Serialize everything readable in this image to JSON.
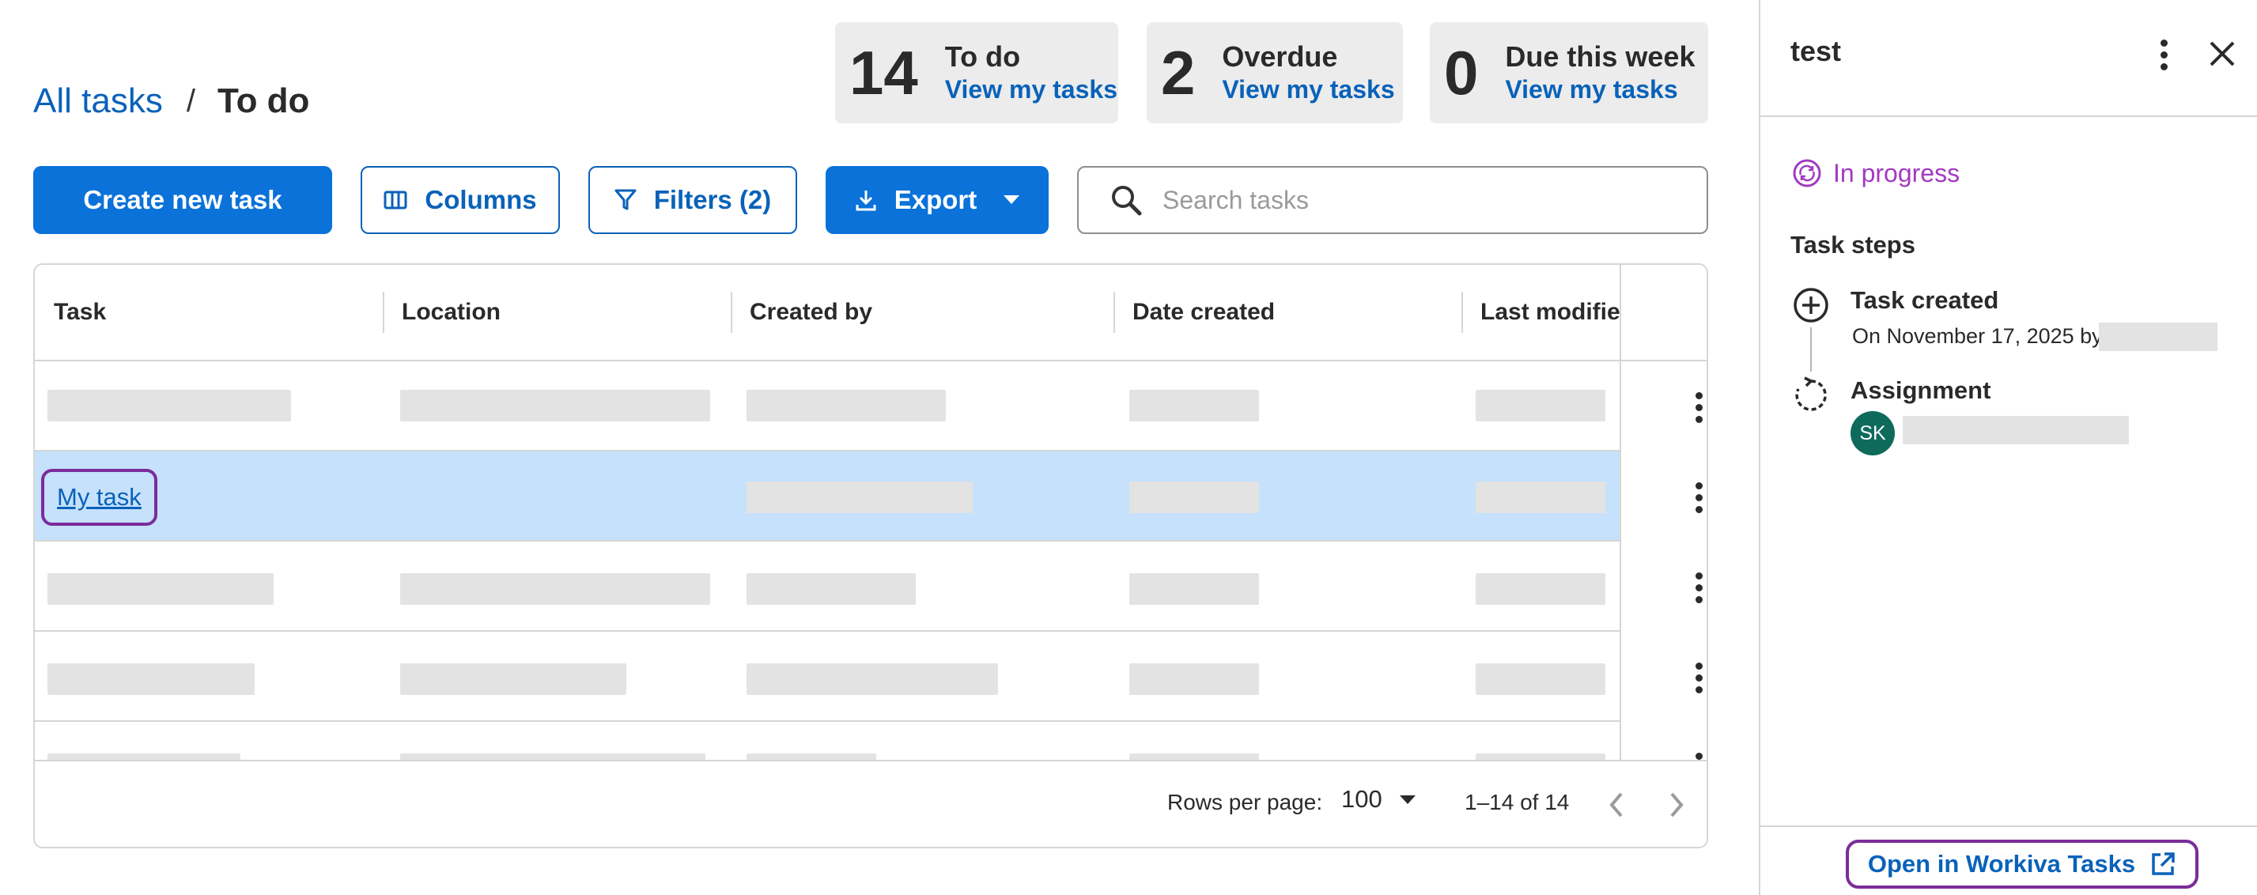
{
  "breadcrumb": {
    "root": "All tasks",
    "separator": "/",
    "current": "To do"
  },
  "stats": [
    {
      "count": "14",
      "label": "To do",
      "link": "View my tasks"
    },
    {
      "count": "2",
      "label": "Overdue",
      "link": "View my tasks"
    },
    {
      "count": "0",
      "label": "Due this week",
      "link": "View my tasks"
    }
  ],
  "toolbar": {
    "create_label": "Create new task",
    "columns_label": "Columns",
    "filters_label": "Filters (2)",
    "export_label": "Export",
    "search_placeholder": "Search tasks"
  },
  "table": {
    "columns": [
      "Task",
      "Location",
      "Created by",
      "Date created",
      "Last modifie"
    ],
    "selected_task": "My task"
  },
  "pagination": {
    "rows_label": "Rows per page:",
    "rows_value": "100",
    "range": "1–14 of 14"
  },
  "panel": {
    "title": "test",
    "status": "In progress",
    "steps_title": "Task steps",
    "steps": [
      {
        "title": "Task created",
        "detail": "On November 17, 2025 by"
      },
      {
        "title": "Assignment",
        "assignee_initials": "SK"
      }
    ],
    "open_label": "Open in Workiva Tasks"
  },
  "colors": {
    "primary": "#0a72d9",
    "link": "#0a62b9",
    "selected_row": "#c6e1fb",
    "status": "#a23ac2",
    "avatar": "#0e6b5b",
    "highlight": "#7b2c9b"
  }
}
